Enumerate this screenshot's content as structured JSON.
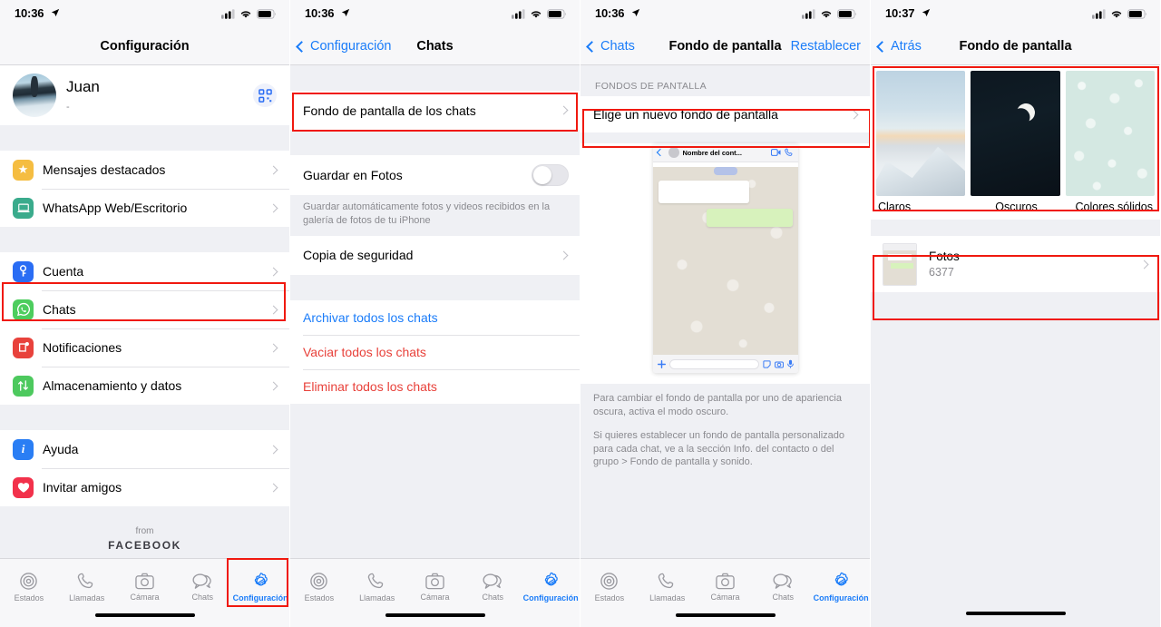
{
  "colors": {
    "accent_blue": "#1a7cf9",
    "highlight_red": "#f0190f",
    "destructive_red": "#e8413a",
    "list_bg": "#eff0f4",
    "whatsapp_green": "#25d366"
  },
  "panels": [
    {
      "id": "settings",
      "status": {
        "time": "10:36",
        "location_icon": "location-arrow-icon"
      },
      "nav": {
        "title": "Configuración"
      },
      "profile": {
        "name": "Juan",
        "subtitle": "-",
        "qr_icon": "qr-code-icon"
      },
      "groups": [
        {
          "items": [
            {
              "label": "Mensajes destacados",
              "icon": "star-icon",
              "color": "#f5bd41"
            },
            {
              "label": "WhatsApp Web/Escritorio",
              "icon": "laptop-icon",
              "color": "#3aab8c"
            }
          ]
        },
        {
          "items": [
            {
              "label": "Cuenta",
              "icon": "key-icon",
              "color": "#2a6df4"
            },
            {
              "label": "Chats",
              "icon": "whatsapp-icon",
              "color": "#4dcd5e",
              "highlighted": true
            },
            {
              "label": "Notificaciones",
              "icon": "bell-badge-icon",
              "color": "#e8423c"
            },
            {
              "label": "Almacenamiento y datos",
              "icon": "arrows-updown-icon",
              "color": "#4dc95e"
            }
          ]
        },
        {
          "items": [
            {
              "label": "Ayuda",
              "icon": "info-icon",
              "color": "#2a7ef4"
            },
            {
              "label": "Invitar amigos",
              "icon": "heart-icon",
              "color": "#f2314b"
            }
          ]
        }
      ],
      "footer": {
        "from": "from",
        "brand": "FACEBOOK"
      }
    },
    {
      "id": "chats",
      "status": {
        "time": "10:36",
        "location_icon": "location-arrow-icon"
      },
      "nav": {
        "back": "Configuración",
        "title": "Chats"
      },
      "wallpaper_row": {
        "label": "Fondo de pantalla de los chats",
        "highlighted": true
      },
      "save_photos": {
        "label": "Guardar en Fotos",
        "toggle_on": false
      },
      "save_photos_note": "Guardar automáticamente fotos y videos recibidos en la galería de fotos de tu iPhone",
      "backup_row": {
        "label": "Copia de seguridad"
      },
      "actions": [
        {
          "label": "Archivar todos los chats",
          "style": "blue"
        },
        {
          "label": "Vaciar todos los chats",
          "style": "red"
        },
        {
          "label": "Eliminar todos los chats",
          "style": "red"
        }
      ]
    },
    {
      "id": "wallpaper",
      "status": {
        "time": "10:36",
        "location_icon": "location-arrow-icon"
      },
      "nav": {
        "back": "Chats",
        "title": "Fondo de pantalla",
        "right_action": "Restablecer"
      },
      "section_header": "FONDOS DE PANTALLA",
      "choose_row": {
        "label": "Elige un nuevo fondo de pantalla",
        "highlighted": true
      },
      "preview": {
        "contact_name": "Nombre del cont...",
        "video_icon": "video-camera-icon",
        "call_icon": "phone-icon",
        "plus_icon": "plus-icon",
        "sticker_icon": "sticker-icon",
        "camera_icon": "camera-icon",
        "mic_icon": "microphone-icon"
      },
      "notes": [
        "Para cambiar el fondo de pantalla por uno de apariencia oscura, activa el modo oscuro.",
        "Si quieres establecer un fondo de pantalla personalizado para cada chat, ve a la sección Info. del contacto o del grupo > Fondo de pantalla y sonido."
      ]
    },
    {
      "id": "wallpaper-picker",
      "status": {
        "time": "10:37",
        "location_icon": "location-arrow-icon"
      },
      "nav": {
        "back": "Atrás",
        "title": "Fondo de pantalla"
      },
      "categories": [
        {
          "label": "Claros",
          "thumb": "light-mountain-thumb"
        },
        {
          "label": "Oscuros",
          "thumb": "dark-moon-thumb"
        },
        {
          "label": "Colores sólidos",
          "thumb": "solid-teal-pattern-thumb"
        }
      ],
      "photos_row": {
        "title": "Fotos",
        "count": "6377",
        "thumb": "chat-preview-thumb"
      }
    }
  ],
  "tabbar": {
    "items": [
      {
        "label": "Estados",
        "icon": "status-rings-icon",
        "active": false
      },
      {
        "label": "Llamadas",
        "icon": "phone-icon",
        "active": false
      },
      {
        "label": "Cámara",
        "icon": "camera-icon",
        "active": false
      },
      {
        "label": "Chats",
        "icon": "chat-bubbles-icon",
        "active": false
      },
      {
        "label": "Configuración",
        "icon": "gear-icon",
        "active": true
      }
    ]
  }
}
